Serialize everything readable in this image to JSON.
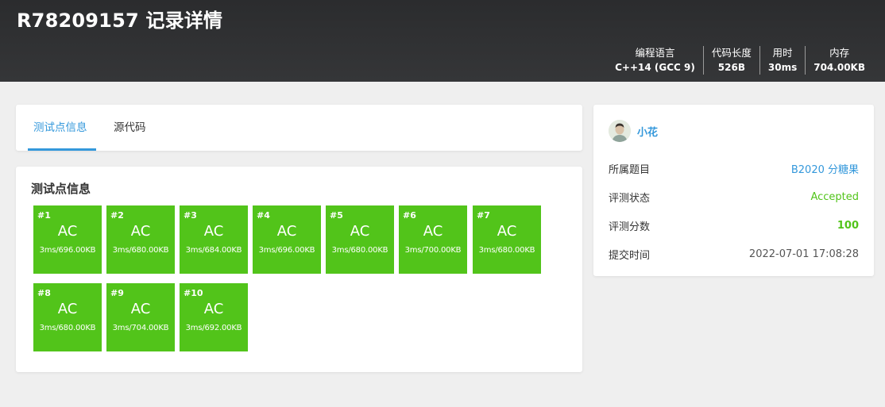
{
  "header": {
    "title": "R78209157 记录详情",
    "stats": [
      {
        "label": "编程语言",
        "value": "C++14 (GCC 9)"
      },
      {
        "label": "代码长度",
        "value": "526B"
      },
      {
        "label": "用时",
        "value": "30ms"
      },
      {
        "label": "内存",
        "value": "704.00KB"
      }
    ]
  },
  "tabs": [
    {
      "label": "测试点信息",
      "active": true
    },
    {
      "label": "源代码",
      "active": false
    }
  ],
  "cases_section": {
    "title": "测试点信息",
    "cases": [
      {
        "id": "#1",
        "status": "AC",
        "meta": "3ms/696.00KB"
      },
      {
        "id": "#2",
        "status": "AC",
        "meta": "3ms/680.00KB"
      },
      {
        "id": "#3",
        "status": "AC",
        "meta": "3ms/684.00KB"
      },
      {
        "id": "#4",
        "status": "AC",
        "meta": "3ms/696.00KB"
      },
      {
        "id": "#5",
        "status": "AC",
        "meta": "3ms/680.00KB"
      },
      {
        "id": "#6",
        "status": "AC",
        "meta": "3ms/700.00KB"
      },
      {
        "id": "#7",
        "status": "AC",
        "meta": "3ms/680.00KB"
      },
      {
        "id": "#8",
        "status": "AC",
        "meta": "3ms/680.00KB"
      },
      {
        "id": "#9",
        "status": "AC",
        "meta": "3ms/704.00KB"
      },
      {
        "id": "#10",
        "status": "AC",
        "meta": "3ms/692.00KB"
      }
    ]
  },
  "user": {
    "name": "小花",
    "info": [
      {
        "label": "所属题目",
        "value": "B2020 分糖果",
        "style": "link"
      },
      {
        "label": "评测状态",
        "value": "Accepted",
        "style": "accepted"
      },
      {
        "label": "评测分数",
        "value": "100",
        "style": "score"
      },
      {
        "label": "提交时间",
        "value": "2022-07-01 17:08:28",
        "style": "plain"
      }
    ]
  },
  "colors": {
    "accent": "#3498db",
    "ac_green": "#52c41a",
    "header_bg": "#303133"
  }
}
